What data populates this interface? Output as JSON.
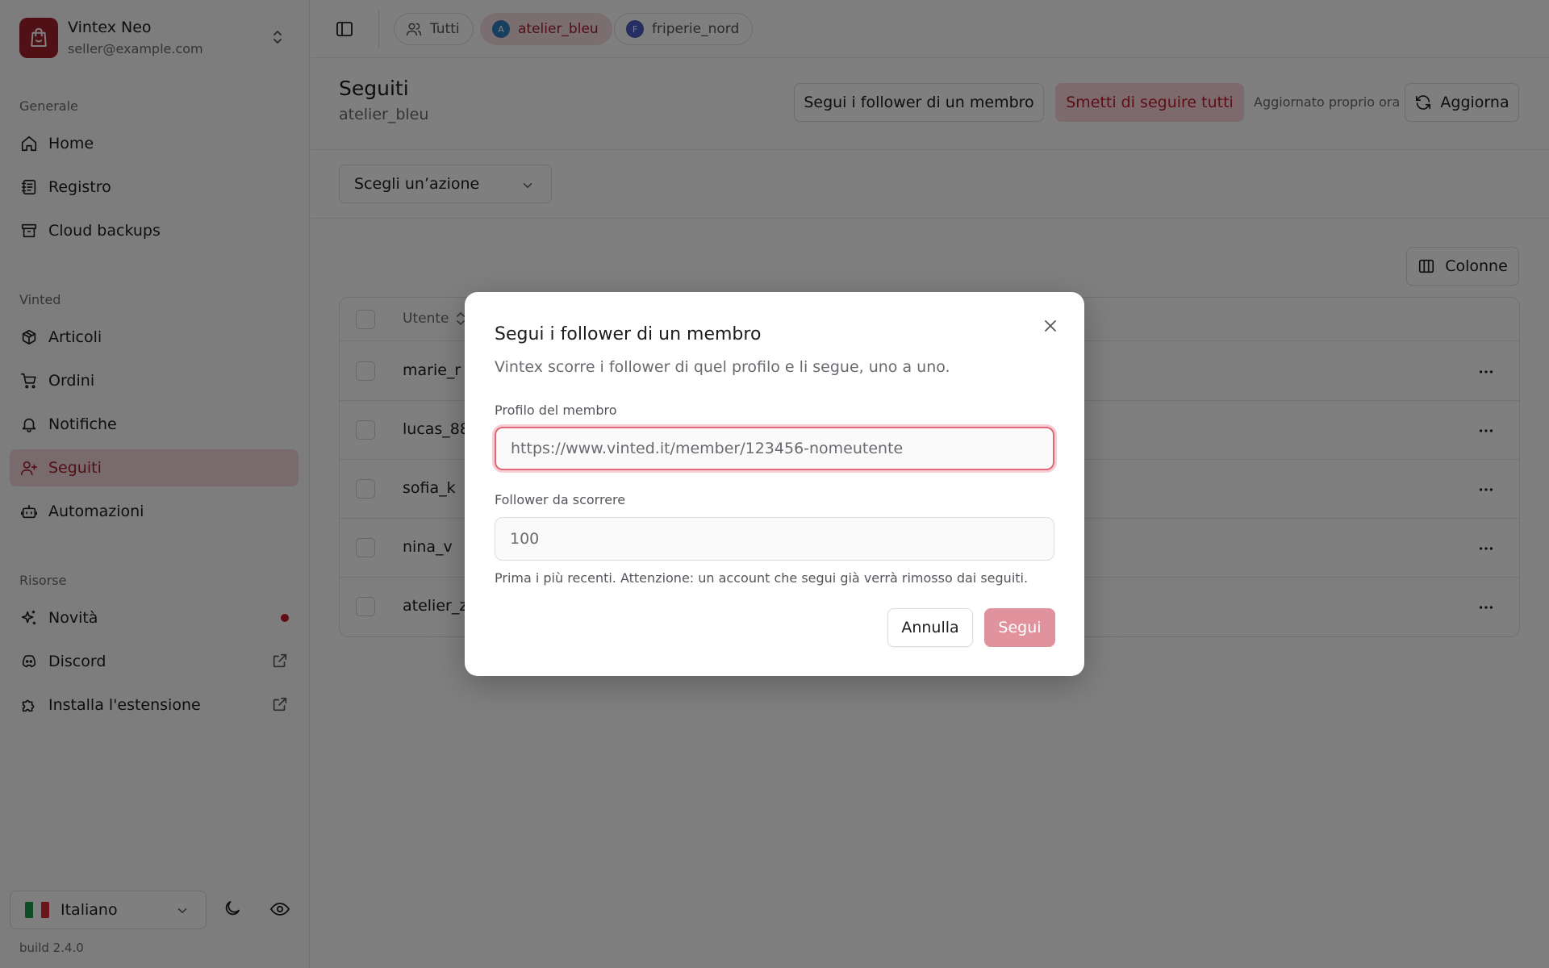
{
  "account": {
    "name": "Vintex Neo",
    "email": "seller@example.com"
  },
  "sidebar": {
    "sections": [
      {
        "label": "Generale",
        "items": [
          {
            "label": "Home",
            "icon": "home-icon"
          },
          {
            "label": "Registro",
            "icon": "logbook-icon"
          },
          {
            "label": "Cloud backups",
            "icon": "archive-icon"
          }
        ]
      },
      {
        "label": "Vinted",
        "items": [
          {
            "label": "Articoli",
            "icon": "package-icon"
          },
          {
            "label": "Ordini",
            "icon": "cart-icon"
          },
          {
            "label": "Notifiche",
            "icon": "bell-icon"
          },
          {
            "label": "Seguiti",
            "icon": "user-plus-icon",
            "active": true
          },
          {
            "label": "Automazioni",
            "icon": "bot-icon"
          }
        ]
      },
      {
        "label": "Risorse",
        "items": [
          {
            "label": "Novità",
            "icon": "sparkles-icon",
            "badge": "dot"
          },
          {
            "label": "Discord",
            "icon": "discord-icon",
            "external": true
          },
          {
            "label": "Installa l'estensione",
            "icon": "puzzle-icon",
            "external": true
          }
        ]
      }
    ],
    "language": "Italiano",
    "build": "build 2.4.0"
  },
  "topbar": {
    "chips": [
      {
        "label": "Tutti",
        "icon": "users-icon"
      },
      {
        "label": "atelier_bleu",
        "avatar": "A",
        "avatar_color": "#2f7fc1",
        "active": true
      },
      {
        "label": "friperie_nord",
        "avatar": "F",
        "avatar_color": "#4b5bc4"
      }
    ]
  },
  "page": {
    "title": "Seguiti",
    "subtitle": "atelier_bleu",
    "follow_followers_label": "Segui i follower di un membro",
    "unfollow_all_label": "Smetti di seguire tutti",
    "updated_label": "Aggiornato proprio ora",
    "refresh_label": "Aggiorna",
    "action_select_placeholder": "Scegli un’azione",
    "columns_label": "Colonne"
  },
  "table": {
    "header_user": "Utente",
    "rows": [
      "marie_r",
      "lucas_88",
      "sofia_k",
      "nina_v",
      "atelier_z"
    ]
  },
  "dialog": {
    "title": "Segui i follower di un membro",
    "description": "Vintex scorre i follower di quel profilo e li segue, uno a uno.",
    "profile_label": "Profilo del membro",
    "profile_placeholder": "https://www.vinted.it/member/123456-nomeutente",
    "count_label": "Follower da scorrere",
    "count_placeholder": "100",
    "hint": "Prima i più recenti. Attenzione: un account che segui già verrà rimosso dai seguiti.",
    "cancel_label": "Annulla",
    "submit_label": "Segui"
  },
  "colors": {
    "accent": "#a3202b",
    "active_bg": "#f3d6da",
    "danger": "#c21a2a"
  }
}
